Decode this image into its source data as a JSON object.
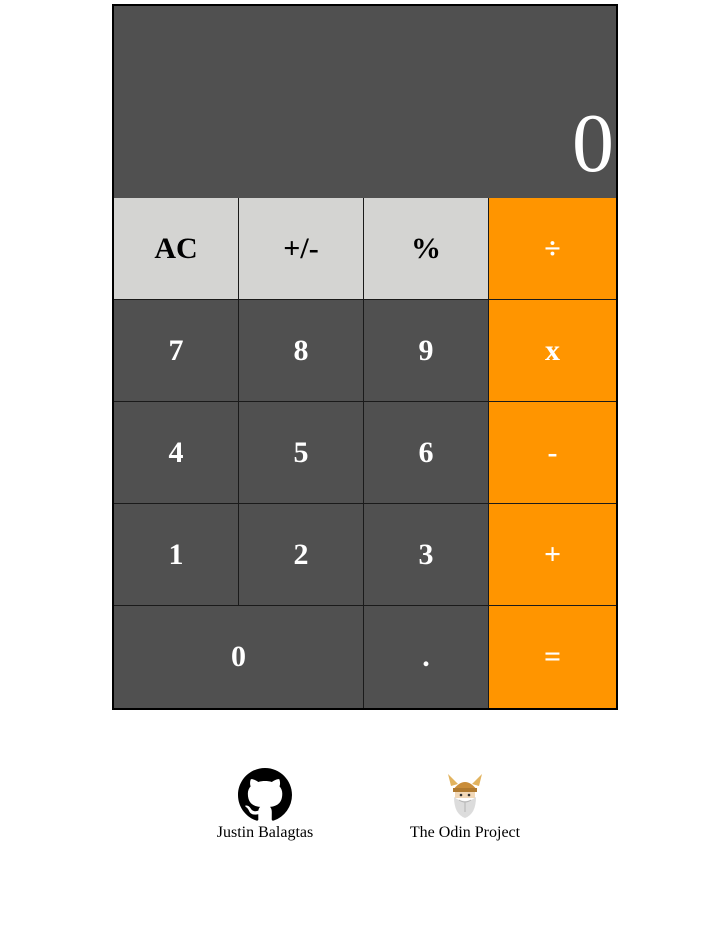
{
  "display": {
    "value": "0"
  },
  "keypad": {
    "ac": "AC",
    "sign": "+/-",
    "percent": "%",
    "divide": "÷",
    "seven": "7",
    "eight": "8",
    "nine": "9",
    "multiply": "x",
    "four": "4",
    "five": "5",
    "six": "6",
    "subtract": "-",
    "one": "1",
    "two": "2",
    "three": "3",
    "add": "+",
    "zero": "0",
    "decimal": ".",
    "equals": "="
  },
  "footer": {
    "github_label": "Justin Balagtas",
    "github_icon": "github-icon",
    "odin_label": "The Odin Project",
    "odin_icon": "odin-project-icon"
  },
  "colors": {
    "display_bg": "#505050",
    "digit_bg": "#505050",
    "function_bg": "#d4d4d2",
    "operator_bg": "#ff9500"
  }
}
